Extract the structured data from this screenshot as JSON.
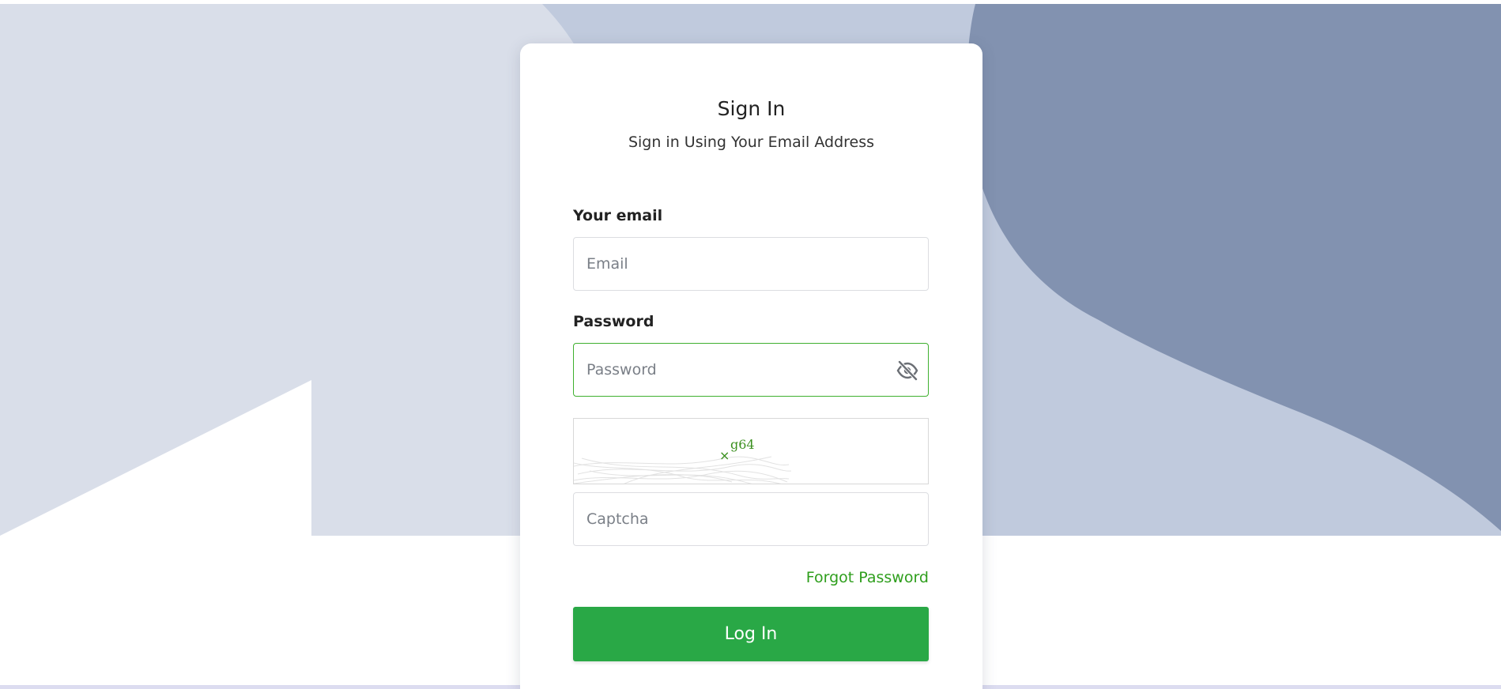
{
  "colors": {
    "accent": "#29a846",
    "link": "#2e9e1c",
    "bg_light": "#d9dee9",
    "bg_mid": "#c0cadd",
    "bg_dark": "#8292b0",
    "captcha_text": "#3a8f1e"
  },
  "header": {
    "title": "Sign In",
    "subtitle": "Sign in Using Your Email Address"
  },
  "form": {
    "email_label": "Your email",
    "email_placeholder": "Email",
    "email_value": "",
    "password_label": "Password",
    "password_placeholder": "Password",
    "password_value": "",
    "password_toggle_icon": "eye-slash-icon",
    "captcha_image_text": "g64",
    "captcha_placeholder": "Captcha",
    "captcha_value": "",
    "forgot_password_label": "Forgot Password",
    "login_button_label": "Log In"
  }
}
